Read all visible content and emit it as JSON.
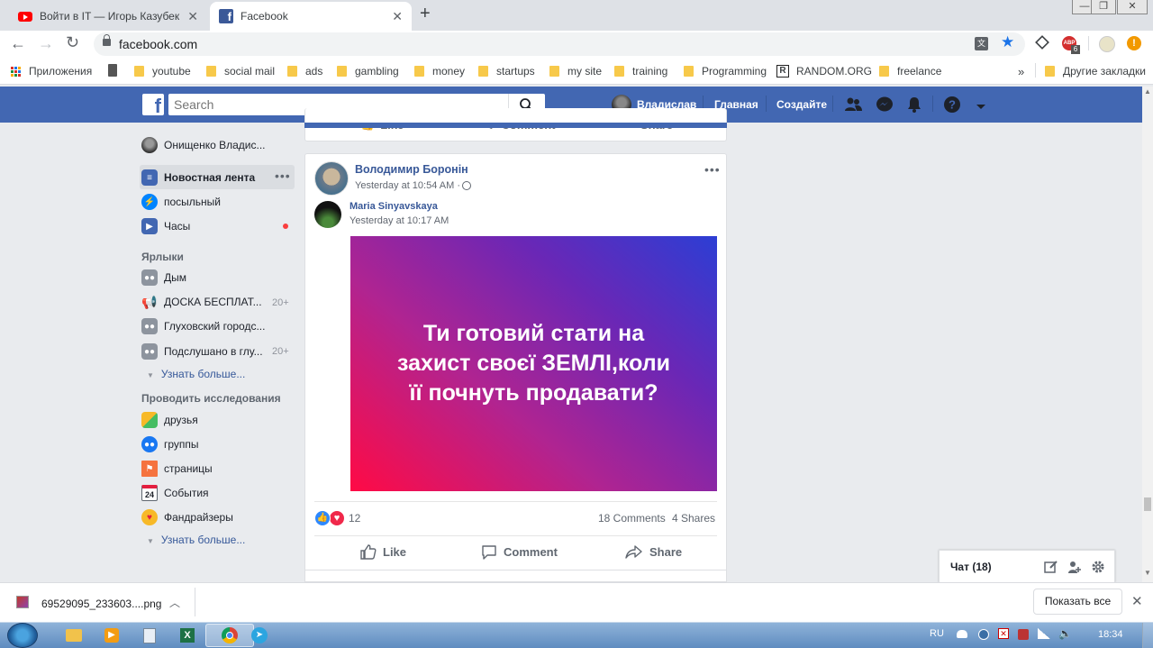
{
  "browser": {
    "tabs": [
      {
        "title": "Войти в IT — Игорь Казубек - Y",
        "active": false
      },
      {
        "title": "Facebook",
        "active": true
      }
    ],
    "new_tab": "+",
    "url": "facebook.com",
    "win_controls": [
      "—",
      "❐",
      "✕"
    ]
  },
  "bookmarks": {
    "apps_label": "Приложения",
    "items": [
      "youtube",
      "social mail",
      "ads",
      "gambling",
      "money",
      "startups",
      "my site",
      "training",
      "Programming",
      "RANDOM.ORG",
      "freelance"
    ],
    "overflow": "»",
    "other_label": "Другие закладки",
    "abp_badge": "6"
  },
  "fb_header": {
    "search_placeholder": "Search",
    "user_name": "Владислав",
    "home": "Главная",
    "create": "Создайте"
  },
  "left_nav": {
    "profile_name": "Онищенко Владис...",
    "items": [
      {
        "label": "Новостная лента"
      },
      {
        "label": "посыльный"
      },
      {
        "label": "Часы"
      }
    ],
    "shortcuts_title": "Ярлыки",
    "shortcuts": [
      {
        "label": "Дым",
        "count": ""
      },
      {
        "label": "ДОСКА БЕСПЛАТ...",
        "count": "20+"
      },
      {
        "label": "Глуховский городс...",
        "count": ""
      },
      {
        "label": "Подслушано в глу...",
        "count": "20+"
      }
    ],
    "see_more_1": "Узнать больше...",
    "explore_title": "Проводить исследования",
    "explore": [
      {
        "label": "друзья"
      },
      {
        "label": "группы"
      },
      {
        "label": "страницы"
      },
      {
        "label": "События",
        "day": "24"
      },
      {
        "label": "Фандрайзеры"
      }
    ],
    "see_more_2": "Узнать больше..."
  },
  "feed": {
    "prev_actions": {
      "like": "Like",
      "comment": "Comment",
      "share": "Share"
    },
    "post": {
      "author": "Володимир Боронін",
      "time": "Yesterday at 10:54 AM · ",
      "shared_author": "Maria Sinyavskaya",
      "shared_time": "Yesterday at 10:17 AM",
      "image_text_lines": [
        "Ти готовий стати на",
        "захист своєї ЗЕМЛІ,коли",
        "її почнуть продавати?"
      ],
      "reactions_count": "12",
      "comments": "18 Comments",
      "shares": "4 Shares",
      "actions": {
        "like": "Like",
        "comment": "Comment",
        "share": "Share"
      }
    }
  },
  "chat": {
    "label": "Чат (18)"
  },
  "download": {
    "filename": "69529095_233603....png",
    "show_all": "Показать все"
  },
  "taskbar": {
    "lang": "RU",
    "time": "18:34"
  }
}
